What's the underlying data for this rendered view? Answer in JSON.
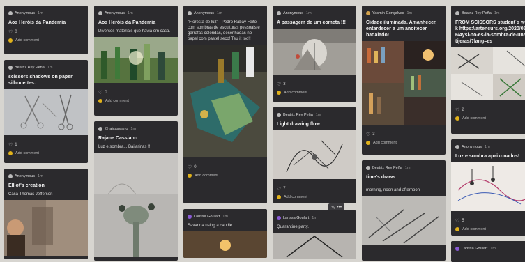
{
  "cards": [
    {
      "author": "Anonymous",
      "time": "1m",
      "title": "Aos Heróis da Pandemia",
      "body": "",
      "likes": "0",
      "add": "Add comment"
    },
    {
      "author": "Beatriz Rey Peña",
      "time": "1m",
      "title": "scissors shadows on paper silhouettes.",
      "body": "",
      "likes": "1",
      "add": "Add comment"
    },
    {
      "author": "Anonymous",
      "time": "1m",
      "title": "Elliot's creation",
      "body": "Casa Thomas Jefferson",
      "likes": "",
      "add": ""
    },
    {
      "author": "Anonymous",
      "time": "1m",
      "title": "Aos Heróis da Pandemia",
      "body": "Diversos materiais que havia em casa.",
      "likes": "0",
      "add": "Add comment"
    },
    {
      "author": "@rajcassiano",
      "time": "1m",
      "title": "Rajane Cassiano",
      "body": "Luz e sombra... Bailarinas !!",
      "likes": "",
      "add": ""
    },
    {
      "author": "Anonymous",
      "time": "1m",
      "title": "",
      "body": "\"Floresta de luz\" - Pedro Rabay Feito com sombras de esculturas pessoais e garrafas coloridas, desenhadas no papel com pastel seco! Teu it too!!",
      "likes": "0",
      "add": "Add comment"
    },
    {
      "author": "Larissa Goulart",
      "time": "1m",
      "title": "",
      "body": "Savanna using a candle.",
      "likes": "",
      "add": ""
    },
    {
      "author": "Anonymous",
      "time": "1m",
      "title": "A passagem de um cometa !!!",
      "body": "",
      "likes": "3",
      "add": "Add comment"
    },
    {
      "author": "Beatriz Rey Peña",
      "time": "1m",
      "title": "Light drawing flow",
      "body": "",
      "likes": "7",
      "add": "Add comment"
    },
    {
      "author": "Larissa Goulart",
      "time": "1m",
      "title": "",
      "body": "Quarantine party.",
      "likes": "",
      "add": ""
    },
    {
      "author": "Yasmin Gonçalves",
      "time": "1m",
      "title": "Cidade iluminada. Amanhecer, entardecer e um anoitecer badalado!",
      "body": "",
      "likes": "3",
      "add": "Add comment"
    },
    {
      "author": "Beatriz Rey Peña",
      "time": "1m",
      "title": "time's draws",
      "body": "morning, noon and afternoon",
      "likes": "",
      "add": ""
    },
    {
      "author": "Beatriz Rey Peña",
      "time": "1m",
      "title": "FROM SCISSORS student´s work https://artencurs.org/2020/05/16/4ysi-no-es-la-sombra-de-unas-tijeras/?lang=es",
      "body": "",
      "likes": "2",
      "add": "Add comment"
    },
    {
      "author": "Anonymous",
      "time": "1m",
      "title": "Luz e sombra apaixonados!",
      "body": "",
      "likes": "5",
      "add": "Add comment"
    },
    {
      "author": "Larissa Goulart",
      "time": "1m",
      "title": "",
      "body": "",
      "likes": "",
      "add": ""
    }
  ],
  "colors": {
    "accent": "#e1b21a",
    "card": "#2b2a2d",
    "background": "#d7d5d0"
  },
  "toolbar": {
    "edit": "✎",
    "more": "•••"
  }
}
